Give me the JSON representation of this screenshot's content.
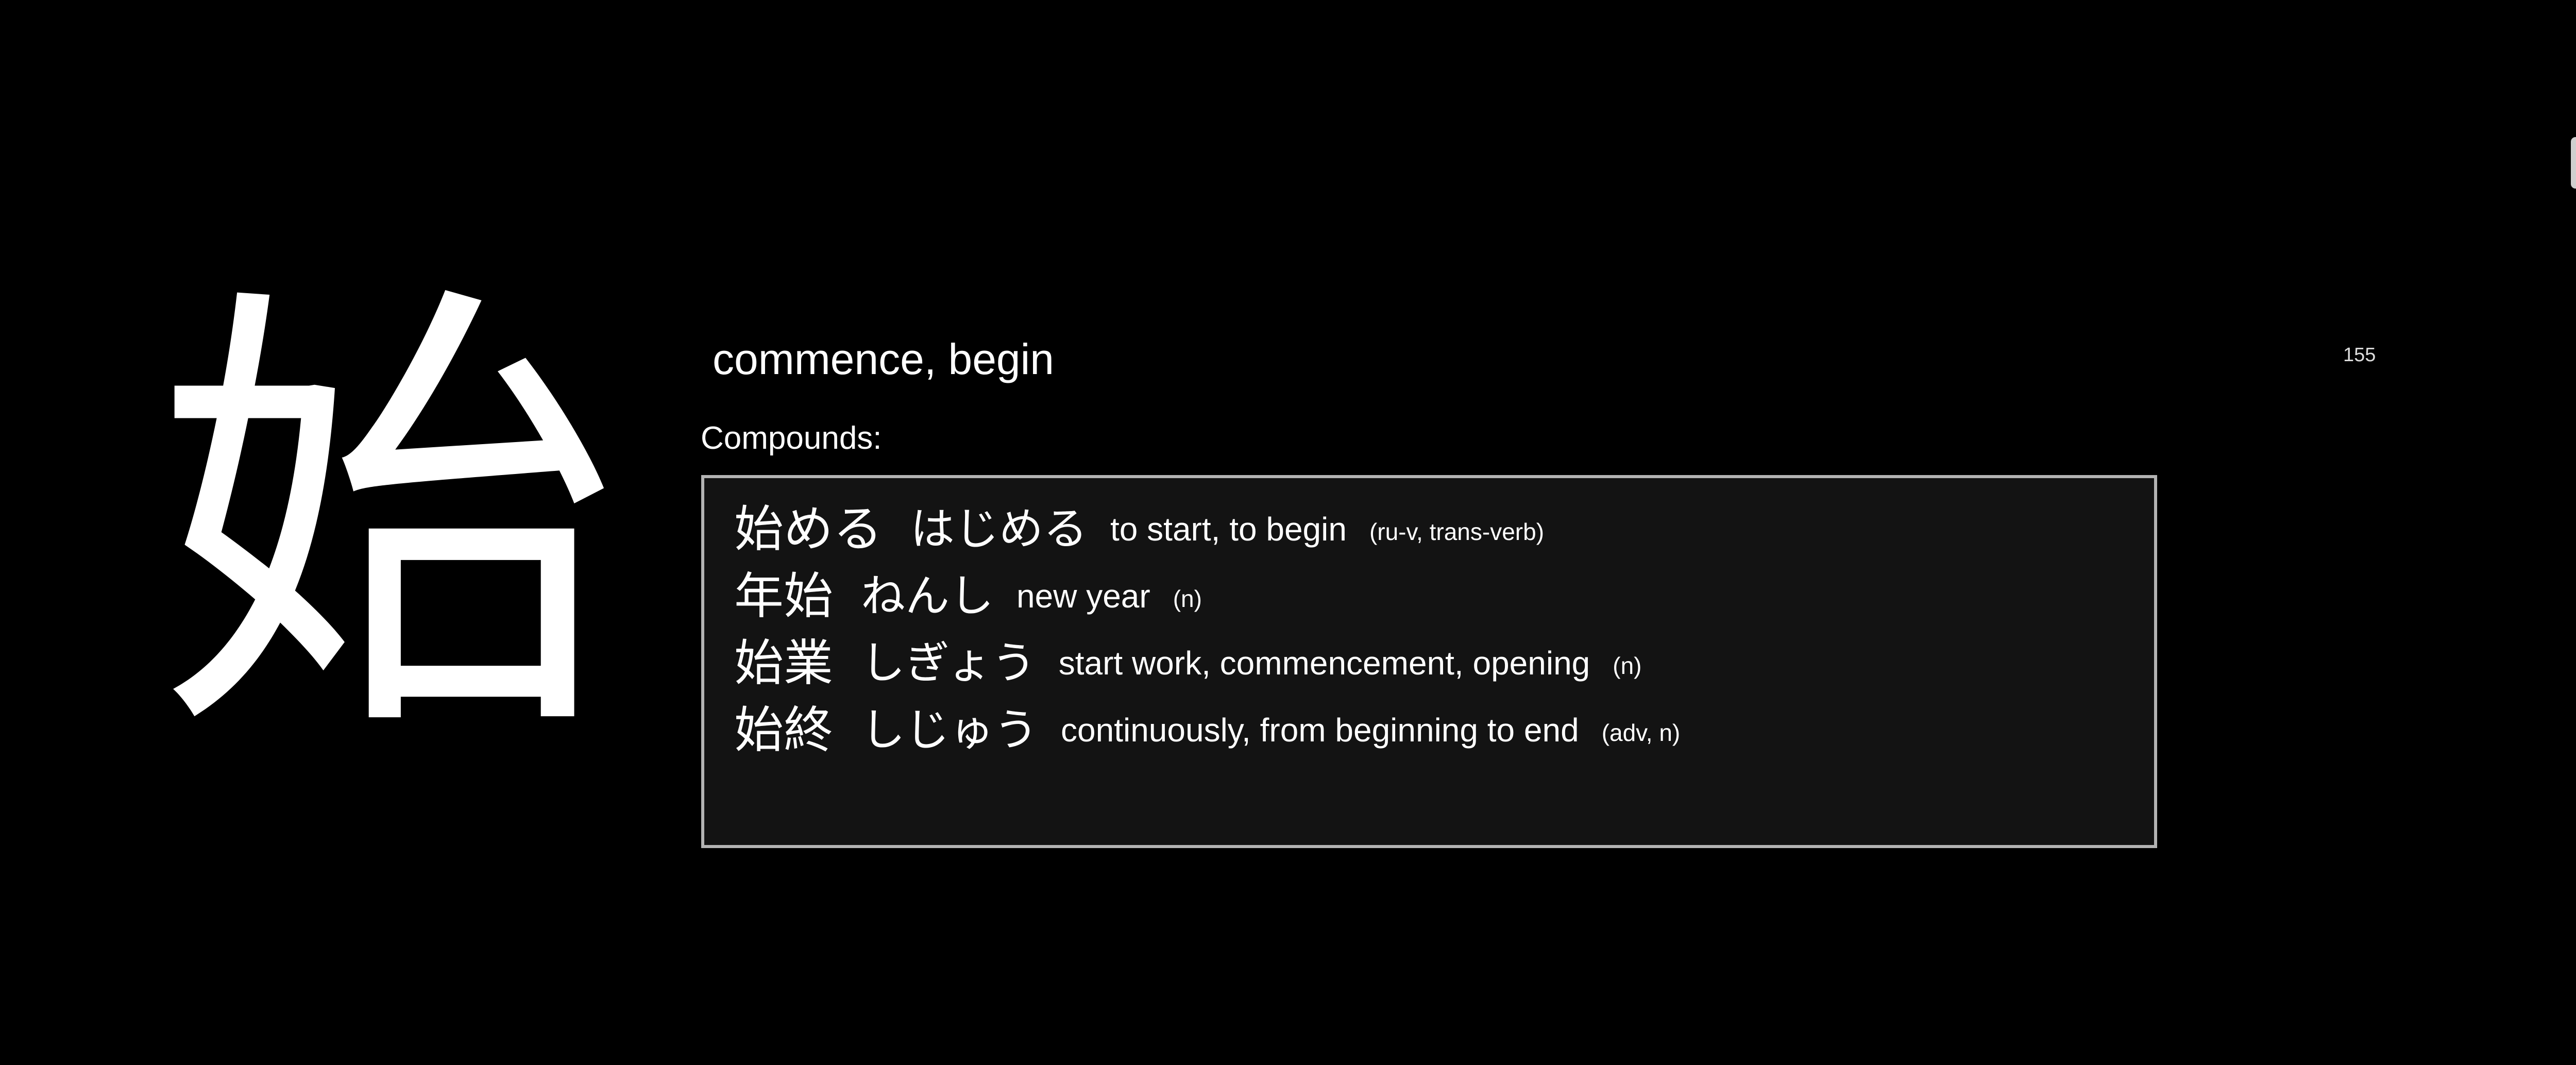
{
  "card": {
    "kanji": "始",
    "meaning": "commence, begin",
    "number": "155",
    "compounds_label": "Compounds:",
    "compounds": [
      {
        "kanji": "始める",
        "kana": "はじめる",
        "gloss": "to start, to begin",
        "pos": "(ru-v, trans-verb)"
      },
      {
        "kanji": "年始",
        "kana": "ねんし",
        "gloss": "new year",
        "pos": "(n)"
      },
      {
        "kanji": "始業",
        "kana": "しぎょう",
        "gloss": "start work, commencement, opening",
        "pos": "(n)"
      },
      {
        "kanji": "始終",
        "kana": "しじゅう",
        "gloss": "continuously, from beginning to end",
        "pos": "(adv, n)"
      }
    ]
  },
  "colors": {
    "background": "#000000",
    "text": "#ffffff",
    "box_background": "#131313",
    "box_border": "#b3b3b3"
  }
}
